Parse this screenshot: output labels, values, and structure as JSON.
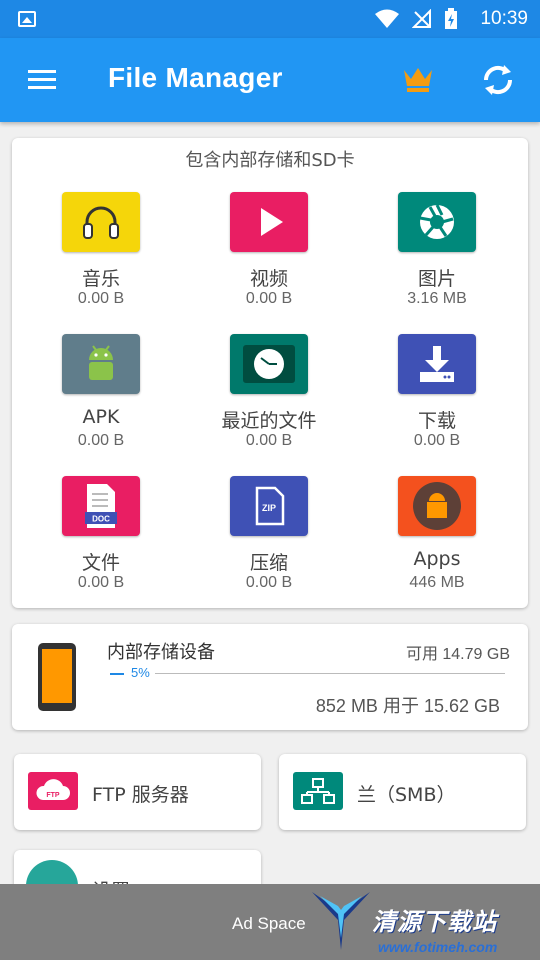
{
  "status_bar": {
    "time": "10:39"
  },
  "app_bar": {
    "title": "File Manager"
  },
  "storage_section": {
    "heading": "包含内部存储和SD卡",
    "categories": [
      {
        "label": "音乐",
        "size": "0.00 B",
        "icon": "headphones-icon",
        "color": "#f5d60a"
      },
      {
        "label": "视频",
        "size": "0.00 B",
        "icon": "play-icon",
        "color": "#e91e63"
      },
      {
        "label": "图片",
        "size": "3.16 MB",
        "icon": "camera-shutter-icon",
        "color": "#00897b"
      },
      {
        "label": "APK",
        "size": "0.00 B",
        "icon": "android-icon",
        "color": "#607d8b"
      },
      {
        "label": "最近的文件",
        "size": "0.00 B",
        "icon": "clock-icon",
        "color": "#00796b"
      },
      {
        "label": "下载",
        "size": "0.00 B",
        "icon": "download-icon",
        "color": "#3f51b5"
      },
      {
        "label": "文件",
        "size": "0.00 B",
        "icon": "document-icon",
        "color": "#e91e63"
      },
      {
        "label": "压缩",
        "size": "0.00 B",
        "icon": "zip-icon",
        "color": "#3f51b5"
      },
      {
        "label": "Apps",
        "size": "446 MB",
        "icon": "apps-icon",
        "color": "#f4511e"
      }
    ]
  },
  "internal_storage": {
    "name": "内部存储设备",
    "available": "可用 14.79 GB",
    "percent_label": "5%",
    "percent_value": 5,
    "used": "852 MB 用于 15.62 GB"
  },
  "shortcuts": {
    "ftp_label": "FTP 服务器",
    "smb_label": "兰（SMB）",
    "settings_label": "设置"
  },
  "ad": {
    "text": "Ad Space",
    "watermark_name": "清源下载站",
    "watermark_url": "www.fotimeh.com"
  }
}
